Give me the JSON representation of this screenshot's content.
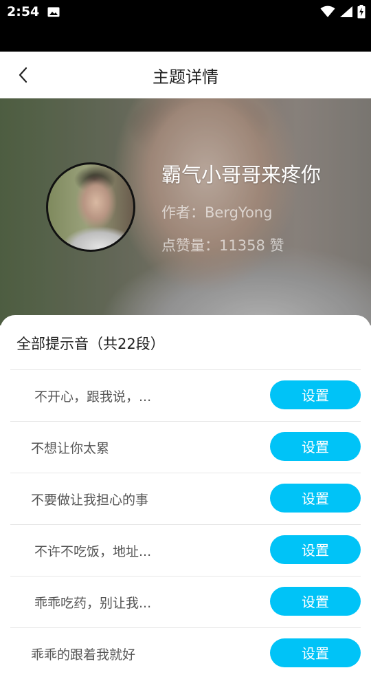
{
  "status_bar": {
    "time": "2:54",
    "icons": [
      "image-icon",
      "wifi-icon",
      "signal-icon",
      "battery-charging-icon"
    ]
  },
  "nav": {
    "title": "主题详情",
    "back_icon": "chevron-left-icon"
  },
  "theme": {
    "title": "霸气小哥哥来疼你",
    "author": "作者：BergYong",
    "likes": "点赞量：11358 赞"
  },
  "sounds": {
    "header": "全部提示音（共22段）",
    "button_label": "设置",
    "accent_color": "#00c3f7",
    "items": [
      {
        "label": "不开心，跟我说，..."
      },
      {
        "label": "不想让你太累"
      },
      {
        "label": "不要做让我担心的事"
      },
      {
        "label": "不许不吃饭，地址..."
      },
      {
        "label": "乖乖吃药，别让我..."
      },
      {
        "label": "乖乖的跟着我就好"
      }
    ]
  }
}
